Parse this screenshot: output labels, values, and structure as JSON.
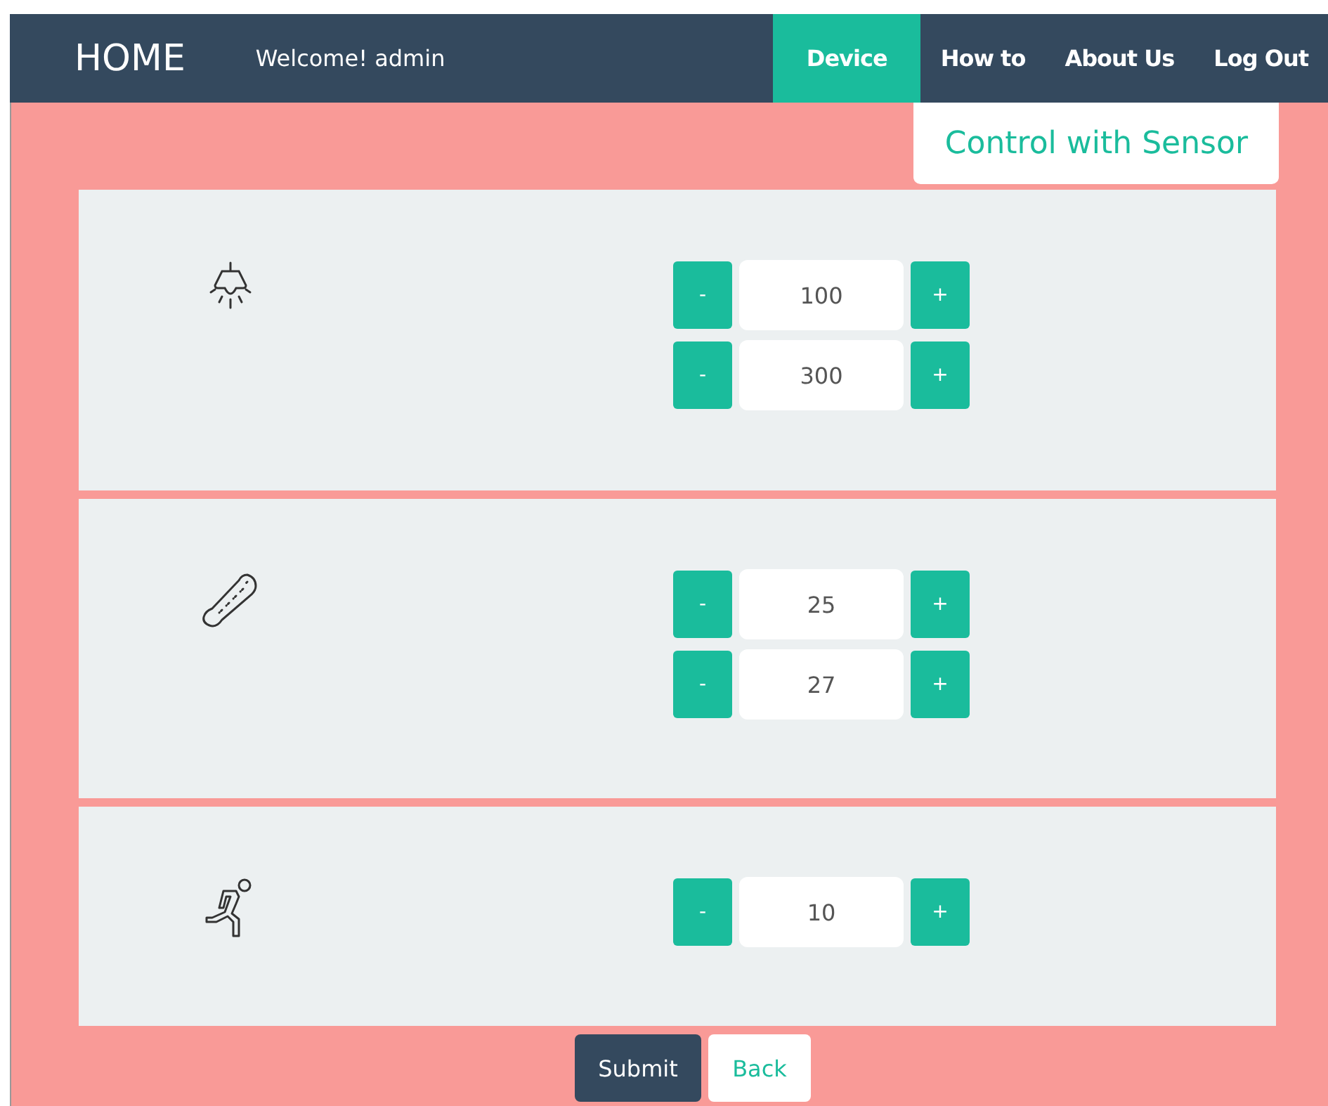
{
  "navbar": {
    "brand": "HOME",
    "welcome": "Welcome! admin",
    "items": [
      {
        "label": "Device",
        "selected": true
      },
      {
        "label": "How to",
        "selected": false
      },
      {
        "label": "About Us",
        "selected": false
      },
      {
        "label": "Log Out",
        "selected": false
      }
    ]
  },
  "tab": {
    "label": "Control with Sensor"
  },
  "sensors": [
    {
      "kind": "lamp",
      "values": [
        {
          "minus": "-",
          "value": "100",
          "plus": "+"
        },
        {
          "minus": "-",
          "value": "300",
          "plus": "+"
        }
      ]
    },
    {
      "kind": "thermometer",
      "values": [
        {
          "minus": "-",
          "value": "25",
          "plus": "+"
        },
        {
          "minus": "-",
          "value": "27",
          "plus": "+"
        }
      ]
    },
    {
      "kind": "motion",
      "values": [
        {
          "minus": "-",
          "value": "10",
          "plus": "+"
        }
      ]
    }
  ],
  "buttons": {
    "submit": "Submit",
    "back": "Back"
  }
}
